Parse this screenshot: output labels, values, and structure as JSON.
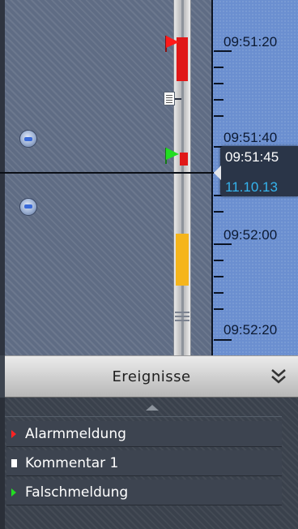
{
  "timeline": {
    "time_ticks": [
      "09:51:20",
      "09:51:40",
      "09:52:00",
      "09:52:20"
    ],
    "cursor": {
      "time": "09:51:45",
      "date": "11.10.13"
    },
    "colors": {
      "alarm": "#e01818",
      "false_alarm": "#22dd22",
      "highlight": "#f5b51c",
      "date_text": "#35b4ee"
    },
    "icons": [
      "alarm-flag-icon",
      "comment-icon",
      "false-alarm-flag-icon",
      "jump-up-icon",
      "jump-down-icon"
    ]
  },
  "events_panel": {
    "title": "Ereignisse",
    "collapse_icon": "double-chevron-down-icon",
    "scroll_icon": "triangle-up-icon",
    "items": [
      {
        "label": "Alarmmeldung",
        "marker": "red-triangle-icon"
      },
      {
        "label": "Kommentar 1",
        "marker": "document-icon"
      },
      {
        "label": "Falschmeldung",
        "marker": "green-triangle-icon"
      }
    ]
  }
}
